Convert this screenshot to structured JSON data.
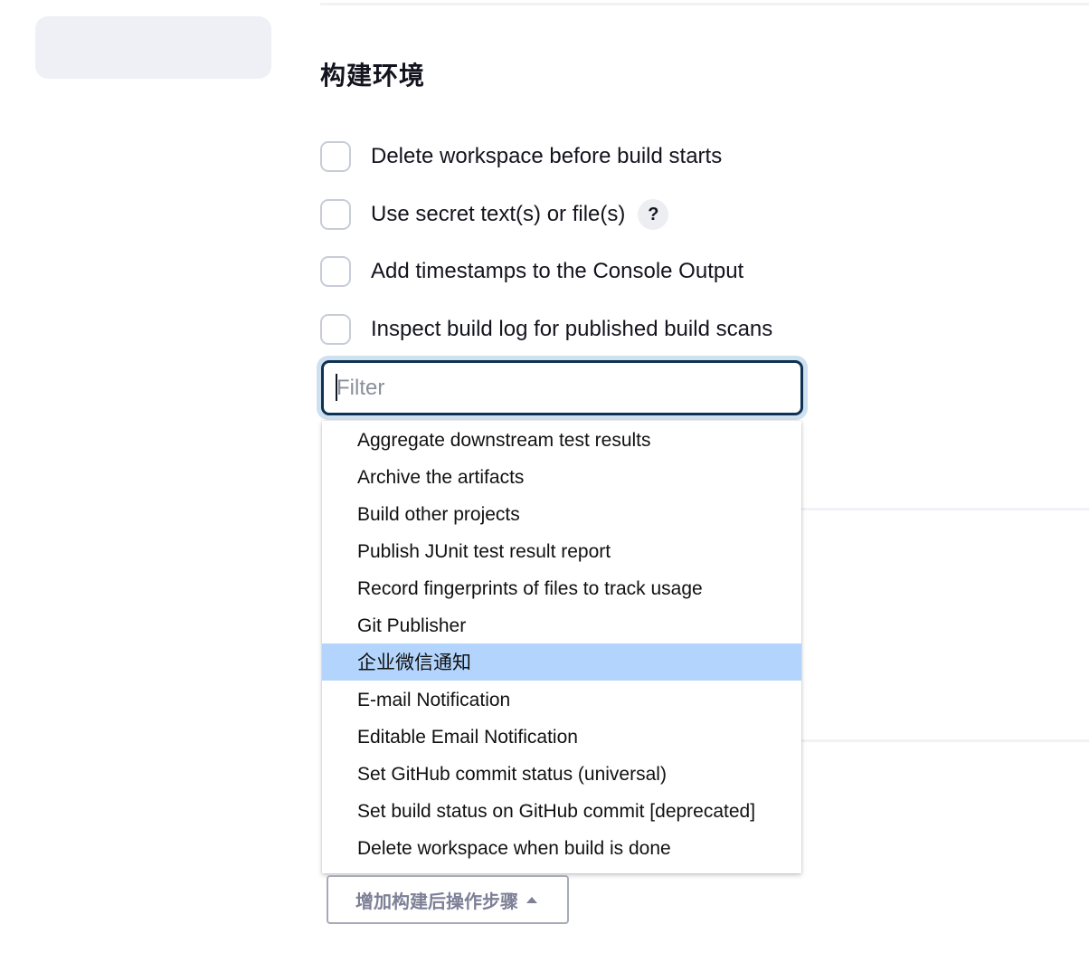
{
  "section": {
    "title": "构建环境"
  },
  "options": [
    {
      "label": "Delete workspace before build starts",
      "checked": false
    },
    {
      "label": "Use secret text(s) or file(s)",
      "checked": false,
      "help": "?"
    },
    {
      "label": "Add timestamps to the Console Output",
      "checked": false
    },
    {
      "label": "Inspect build log for published build scans",
      "checked": false
    }
  ],
  "filter": {
    "placeholder": "Filter",
    "value": ""
  },
  "dropdown": {
    "items": [
      "Aggregate downstream test results",
      "Archive the artifacts",
      "Build other projects",
      "Publish JUnit test result report",
      "Record fingerprints of files to track usage",
      "Git Publisher",
      "企业微信通知",
      "E-mail Notification",
      "Editable Email Notification",
      "Set GitHub commit status (universal)",
      "Set build status on GitHub commit [deprecated]",
      "Delete workspace when build is done"
    ],
    "highlighted_index": 6
  },
  "add_step_button": {
    "label": "增加构建后操作步骤"
  },
  "colors": {
    "accent_focus": "#0d3253",
    "highlight": "#b3d5fd",
    "checkbox_border": "#c8ccd6"
  }
}
